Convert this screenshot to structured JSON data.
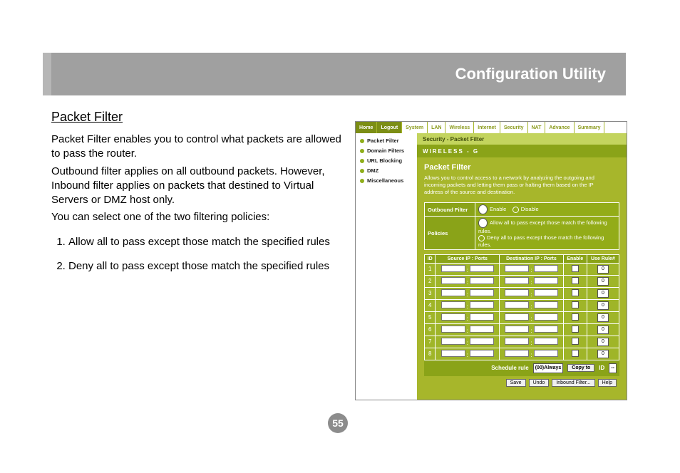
{
  "header": {
    "title": "Configuration Utility"
  },
  "section_title": "Packet Filter",
  "paragraphs": {
    "p1": "Packet Filter enables you to control what packets are allowed to pass the router.",
    "p2": "Outbound filter applies on all outbound packets. However, Inbound filter applies on packets that destined to Virtual Servers or DMZ host only.",
    "p3": "You can select one of the two filtering policies:"
  },
  "policies": {
    "item1": "Allow all to pass except those match the specified rules",
    "item2": "Deny all to pass except those match the specified rules"
  },
  "page_number": "55",
  "screenshot": {
    "tabs": {
      "home": "Home",
      "logout": "Logout",
      "system": "System",
      "lan": "LAN",
      "wireless": "Wireless",
      "internet": "Internet",
      "security": "Security",
      "nat": "NAT",
      "advance": "Advance",
      "summary": "Summary"
    },
    "sidebar": {
      "i0": "Packet Filter",
      "i1": "Domain Filters",
      "i2": "URL Blocking",
      "i3": "DMZ",
      "i4": "Miscellaneous"
    },
    "breadcrumb": "Security - Packet Filter",
    "brand": "WIRELESS - G",
    "panel": {
      "title": "Packet Filter",
      "desc": "Allows you to control access to a network by analyzing the outgoing and incoming packets and letting them pass or halting them based on the IP address of the source and destination.",
      "outbound_label": "Outbound Filter",
      "enable": "Enable",
      "disable": "Disable",
      "policies_label": "Policies",
      "policy_allow": "Allow all to pass except those match the following rules.",
      "policy_deny": "Deny all to pass except those match the following rules."
    },
    "rules": {
      "hdr_id": "ID",
      "hdr_src": "Source IP : Ports",
      "hdr_dst": "Destination IP : Ports",
      "hdr_en": "Enable",
      "hdr_use": "Use Rule#",
      "ids": {
        "r1": "1",
        "r2": "2",
        "r3": "3",
        "r4": "4",
        "r5": "5",
        "r6": "6",
        "r7": "7",
        "r8": "8"
      },
      "zero": "0"
    },
    "schedule": {
      "label": "Schedule rule",
      "always": "(00)Always",
      "copy": "Copy to",
      "idlbl": "ID",
      "idsel": "--"
    },
    "buttons": {
      "save": "Save",
      "undo": "Undo",
      "inbound": "Inbound Filter...",
      "help": "Help"
    }
  }
}
